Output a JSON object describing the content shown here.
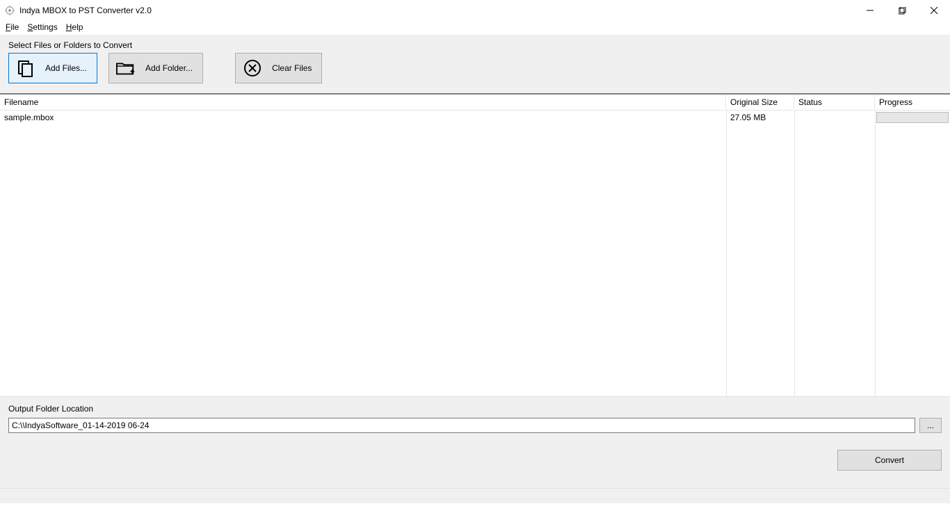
{
  "window": {
    "title": "Indya MBOX to PST Converter v2.0"
  },
  "menu": {
    "file": "File",
    "settings": "Settings",
    "help": "Help"
  },
  "toolbar": {
    "section_label": "Select Files or Folders to Convert",
    "add_files": "Add Files...",
    "add_folder": "Add Folder...",
    "clear_files": "Clear Files"
  },
  "table": {
    "headers": {
      "filename": "Filename",
      "original_size": "Original Size",
      "status": "Status",
      "progress": "Progress"
    },
    "rows": [
      {
        "filename": "sample.mbox",
        "original_size": "27.05 MB",
        "status": "",
        "progress": ""
      }
    ]
  },
  "output": {
    "label": "Output Folder Location",
    "path": "C:\\\\IndyaSoftware_01-14-2019 06-24",
    "browse": "..."
  },
  "actions": {
    "convert": "Convert"
  }
}
